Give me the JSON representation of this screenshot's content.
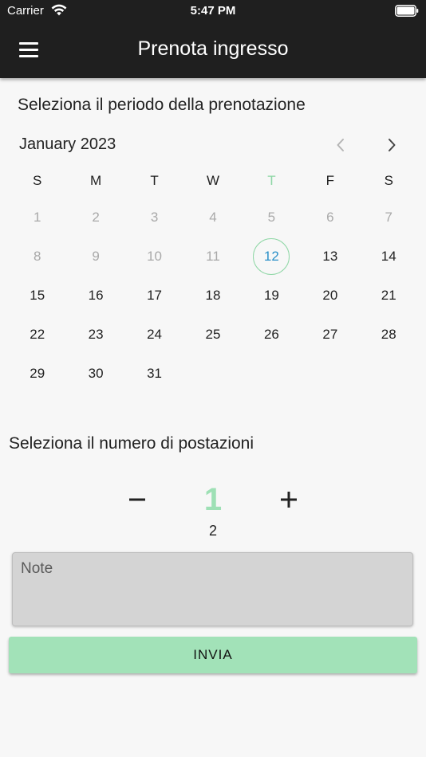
{
  "status_bar": {
    "carrier": "Carrier",
    "time": "5:47 PM"
  },
  "app_bar": {
    "title": "Prenota ingresso",
    "menu_icon": "hamburger-menu-icon"
  },
  "period_section": {
    "title": "Seleziona il periodo della prenotazione"
  },
  "calendar": {
    "month_label": "January 2023",
    "weekdays": [
      "S",
      "M",
      "T",
      "W",
      "T",
      "F",
      "S"
    ],
    "today_weekday_index": 4,
    "weeks": [
      [
        "1",
        "2",
        "3",
        "4",
        "5",
        "6",
        "7"
      ],
      [
        "8",
        "9",
        "10",
        "11",
        "12",
        "13",
        "14"
      ],
      [
        "15",
        "16",
        "17",
        "18",
        "19",
        "20",
        "21"
      ],
      [
        "22",
        "23",
        "24",
        "25",
        "26",
        "27",
        "28"
      ],
      [
        "29",
        "30",
        "31",
        "",
        "",
        "",
        ""
      ]
    ],
    "selected_day": "12",
    "first_enabled_day": 12,
    "colors": {
      "disabled": "#a9a9a9",
      "today_ring": "#8fd7a6",
      "selected_text": "#2b90c8"
    }
  },
  "count_section": {
    "title": "Seleziona il numero di postazioni",
    "value": "1",
    "secondary_value": "2",
    "minus_icon": "minus-icon",
    "plus_icon": "plus-icon"
  },
  "note_field": {
    "placeholder": "Note",
    "value": ""
  },
  "submit_button": {
    "label": "INVIA",
    "color": "#a2e2b8"
  }
}
